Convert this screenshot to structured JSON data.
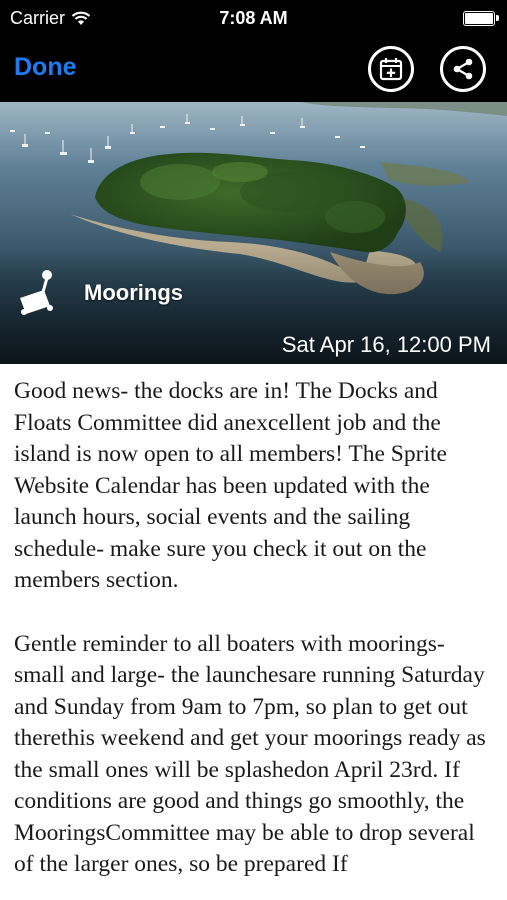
{
  "status_bar": {
    "carrier": "Carrier",
    "time": "7:08 AM",
    "wifi_icon": "wifi-icon",
    "battery_icon": "battery-icon"
  },
  "nav": {
    "done_label": "Done",
    "calendar_icon": "add-to-calendar-icon",
    "share_icon": "share-icon"
  },
  "hero": {
    "title": "Moorings",
    "date": "Sat Apr 16, 12:00 PM",
    "category_icon": "mooring-buoy-icon"
  },
  "article": {
    "paragraphs": [
      "Good news- the docks are in! The Docks and Floats Committee did anexcellent job and the island is now open to all members! The Sprite Website Calendar has been updated with the launch hours, social events and the sailing schedule- make sure you check it out on the members section.",
      "Gentle reminder to all boaters with moorings- small and large- the launchesare running Saturday and Sunday from 9am to 7pm, so plan to get out therethis weekend and get your moorings ready as the small ones will be splashedon April 23rd. If conditions are good and things go smoothly, the MooringsCommittee may be able to drop several of the larger ones, so be prepared If"
    ]
  },
  "colors": {
    "accent": "#1e7cf2",
    "background": "#000000",
    "content_bg": "#ffffff"
  }
}
